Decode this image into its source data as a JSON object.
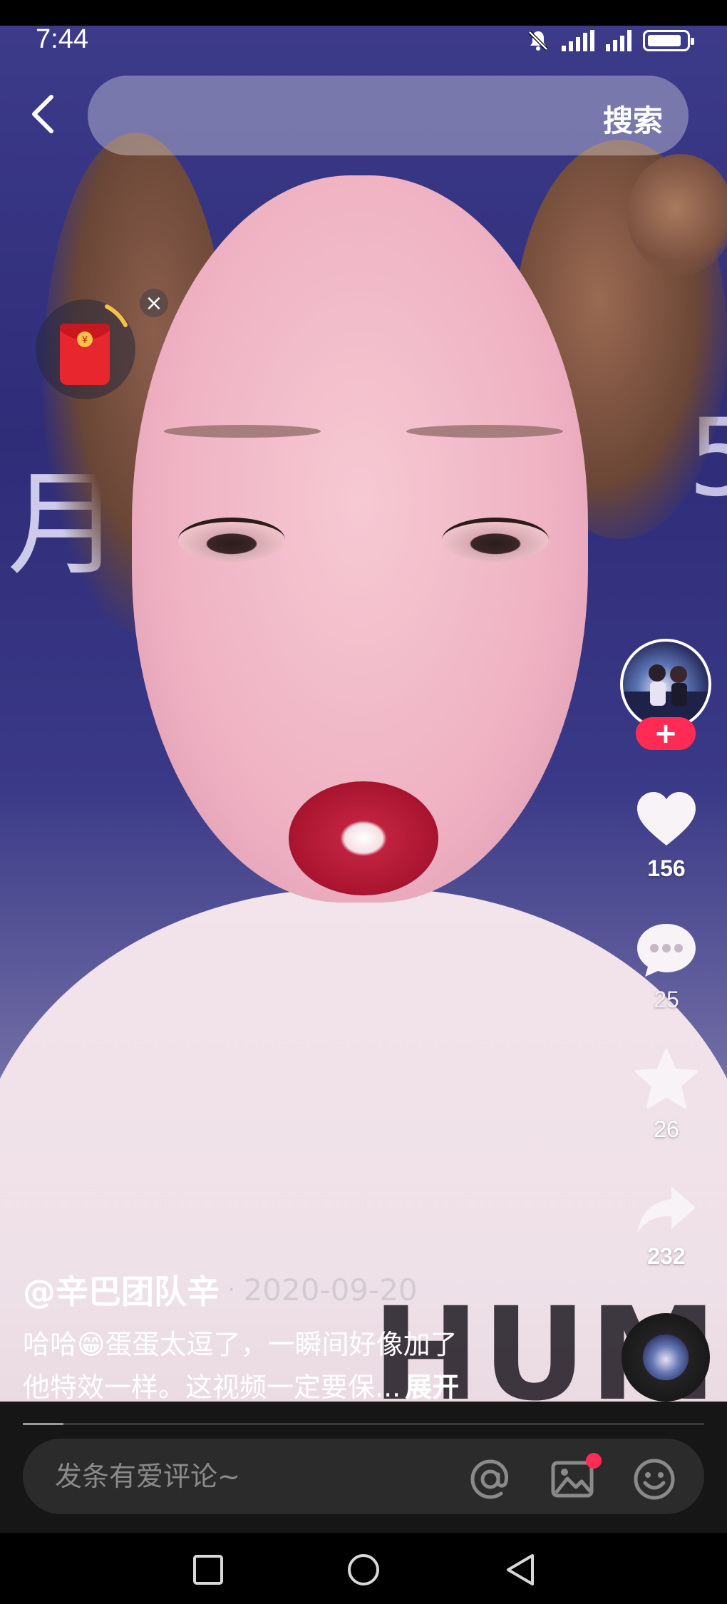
{
  "status_bar": {
    "time": "7:44"
  },
  "search": {
    "button_label": "搜索",
    "value": ""
  },
  "post": {
    "author": "@辛巴团队辛",
    "separator": "·",
    "date": "2020-09-20",
    "caption_line1": "哈哈😁蛋蛋太逗了，一瞬间好像加了",
    "caption_line2": "他特效一样。这视频一定要保...",
    "expand_label": "展开"
  },
  "actions": {
    "follow_label": "+",
    "likes": "156",
    "comments": "25",
    "favorites": "26",
    "shares": "232"
  },
  "comment_bar": {
    "placeholder": "发条有爱评论~"
  },
  "progress": {
    "fraction": 0.06
  },
  "icons": [
    "back-icon",
    "mute-icon",
    "signal-icon",
    "battery-icon",
    "red-packet-icon",
    "close-icon",
    "heart-icon",
    "comment-icon",
    "star-icon",
    "share-icon",
    "music-disc-icon",
    "at-icon",
    "image-icon",
    "emoji-icon",
    "recent-apps-icon",
    "home-icon",
    "nav-back-icon"
  ],
  "colors": {
    "accent": "#fe2c55",
    "bottom_bg": "#161616"
  },
  "video_overlay_text": {
    "left": "月",
    "right": "5",
    "shirt": "HUM"
  }
}
